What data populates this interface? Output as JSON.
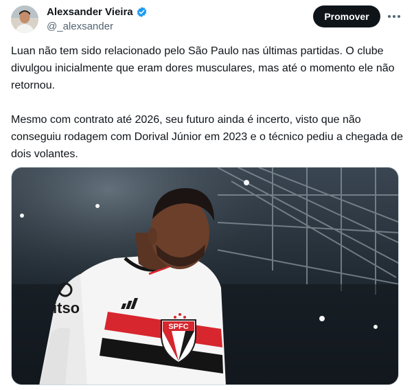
{
  "author": {
    "name": "Alexsander Vieira",
    "handle": "@_alexsander",
    "verified_icon": "verified-badge-icon",
    "avatar_icon": "avatar-photo"
  },
  "actions": {
    "promote_label": "Promover",
    "more_icon": "more-horizontal-icon"
  },
  "tweet": {
    "paragraph_1": "Luan não tem sido relacionado pelo São Paulo nas últimas partidas. O clube divulgou inicialmente que eram dores musculares, mas até o momento ele não retornou.",
    "paragraph_2": "Mesmo com contrato até 2026, seu futuro ainda é incerto, visto que não conseguiu rodagem com Dorival Júnior em 2023 e o técnico pediu a chegada de dois volantes."
  },
  "media": {
    "jersey_sponsor": "itso",
    "jersey_crest": "SPFC"
  },
  "colors": {
    "verified_blue": "#1d9bf0",
    "promote_bg": "#0f1419",
    "handle_gray": "#536471",
    "jersey_red": "#d7262e"
  }
}
